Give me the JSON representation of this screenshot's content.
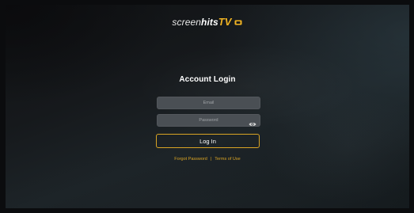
{
  "logo": {
    "screen_text": "screen",
    "hits_text": "hits",
    "tv_text": "TV",
    "accent_color": "#f0b323",
    "icon": "tv-logo-icon"
  },
  "login": {
    "title": "Account Login",
    "email_placeholder": "Email",
    "password_placeholder": "Password",
    "password_toggle_icon": "eye-icon",
    "login_label": "Log In"
  },
  "links": {
    "forgot_password": "Forgot Password",
    "separator": "|",
    "terms": "Terms of Use"
  },
  "colors": {
    "accent": "#d9a424",
    "field_bg": "#4a4f54",
    "background": "#15191c"
  }
}
